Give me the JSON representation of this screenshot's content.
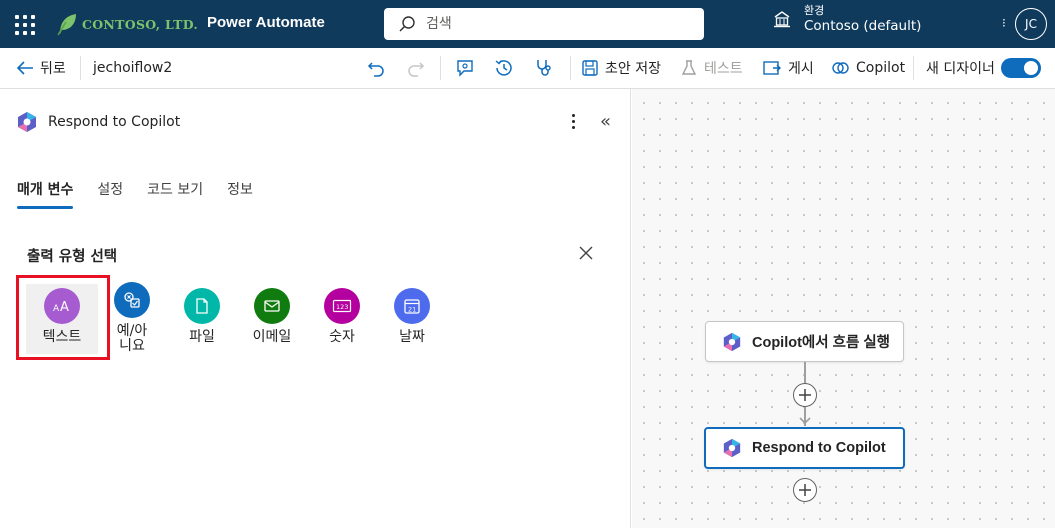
{
  "header": {
    "brand": "CONTOSO, LTD.",
    "product": "Power Automate",
    "search_placeholder": "검색",
    "env_label": "환경",
    "env_name": "Contoso (default)",
    "more_glyph": "⁝",
    "avatar_initials": "JC"
  },
  "toolbar": {
    "back_label": "뒤로",
    "flow_name": "jechoiflow2",
    "save_draft_label": "초안 저장",
    "test_label": "테스트",
    "publish_label": "게시",
    "copilot_label": "Copilot",
    "new_designer_label": "새 디자이너",
    "new_designer_on": true
  },
  "panel": {
    "title": "Respond to Copilot",
    "tabs": [
      {
        "label": "매개 변수",
        "active": true
      },
      {
        "label": "설정",
        "active": false
      },
      {
        "label": "코드 보기",
        "active": false
      },
      {
        "label": "정보",
        "active": false
      }
    ],
    "section_title": "출력 유형 선택",
    "output_types": [
      {
        "label": "텍스트",
        "color": "#a65bd1",
        "icon": "text-icon",
        "selected": true
      },
      {
        "label": "예/아니요",
        "color": "#0f6cbd",
        "icon": "yes-no-icon",
        "selected": false
      },
      {
        "label": "파일",
        "color": "#00b7a8",
        "icon": "file-icon",
        "selected": false
      },
      {
        "label": "이메일",
        "color": "#107c10",
        "icon": "email-icon",
        "selected": false
      },
      {
        "label": "숫자",
        "color": "#b4009e",
        "icon": "number-icon",
        "selected": false
      },
      {
        "label": "날짜",
        "color": "#4f6bed",
        "icon": "date-icon",
        "selected": false
      }
    ]
  },
  "canvas": {
    "nodes": [
      {
        "label": "Copilot에서 흐름 실행",
        "selected": false
      },
      {
        "label": "Respond to Copilot",
        "selected": true
      }
    ]
  }
}
